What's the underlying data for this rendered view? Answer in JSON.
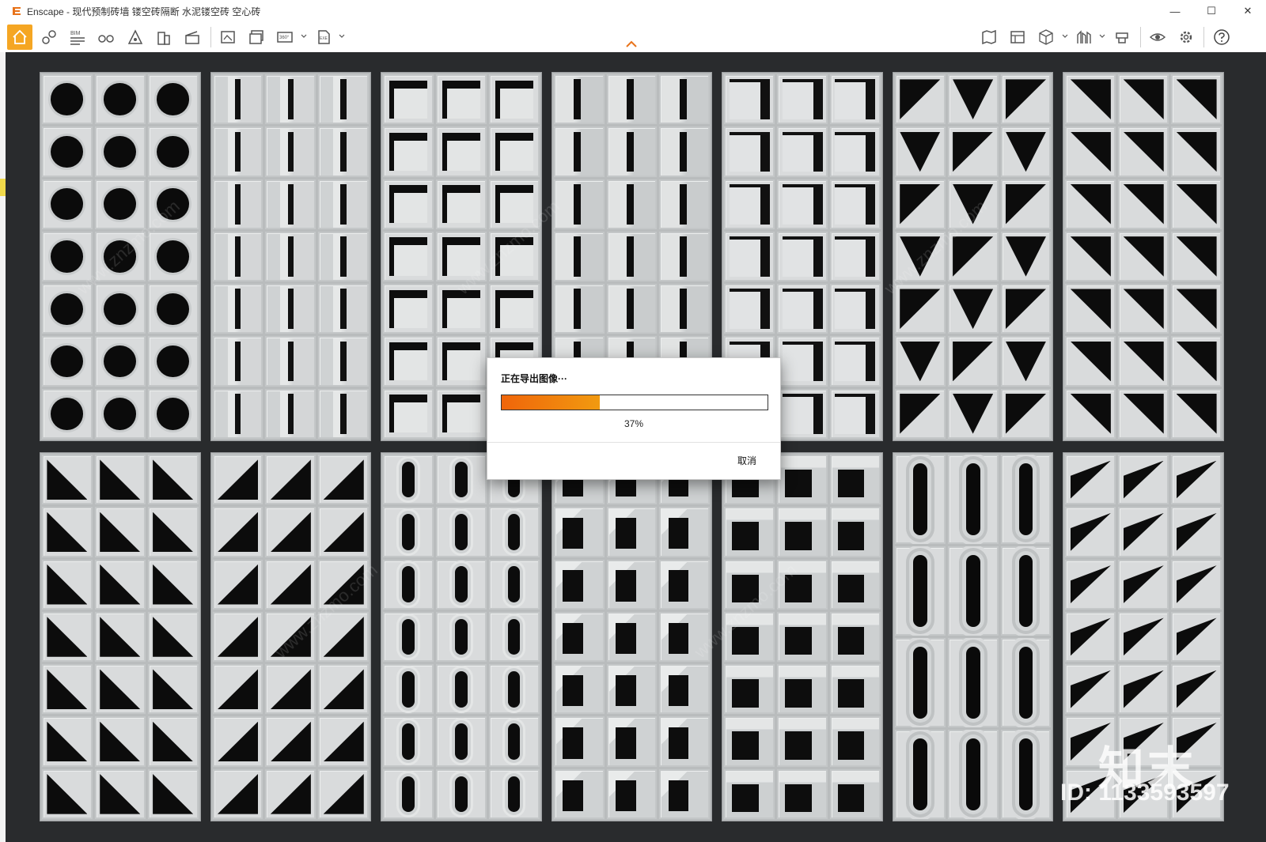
{
  "window": {
    "title": "Enscape - 现代预制砖墙 镂空砖隔断 水泥镂空砖 空心砖",
    "minimize_glyph": "—",
    "maximize_glyph": "☐",
    "close_glyph": "✕"
  },
  "toolbar": {
    "bim_label": "BIM",
    "pano_label": "360°",
    "exe_label": "EXE",
    "icons": [
      "home-icon",
      "walk-mode-icon",
      "bim-icon",
      "binoculars-icon",
      "sound-icon",
      "building-icon",
      "clapboard-icon",
      "screenshot-icon",
      "batch-render-icon",
      "panorama-icon",
      "export-exe-icon",
      "map-icon",
      "asset-library-icon",
      "view-cube-icon",
      "atmosphere-icon",
      "render-settings-icon",
      "visibility-icon",
      "settings-icon",
      "help-icon"
    ],
    "accent_color": "#f5a623"
  },
  "dialog": {
    "title": "正在导出图像···",
    "progress_percent_label": "37%",
    "progress_value": 0.37,
    "cancel_label": "取消",
    "fill_color": "#f0650a"
  },
  "watermark": {
    "text": "www.znzmo.com",
    "brand": "知末",
    "id": "ID: 1133593597"
  },
  "panels": [
    "circle",
    "slit",
    "frame",
    "bar",
    "corner",
    "tri-a",
    "tri-b",
    "tri-d",
    "tri-c",
    "slot",
    "square",
    "box",
    "oval",
    "tri-e"
  ]
}
